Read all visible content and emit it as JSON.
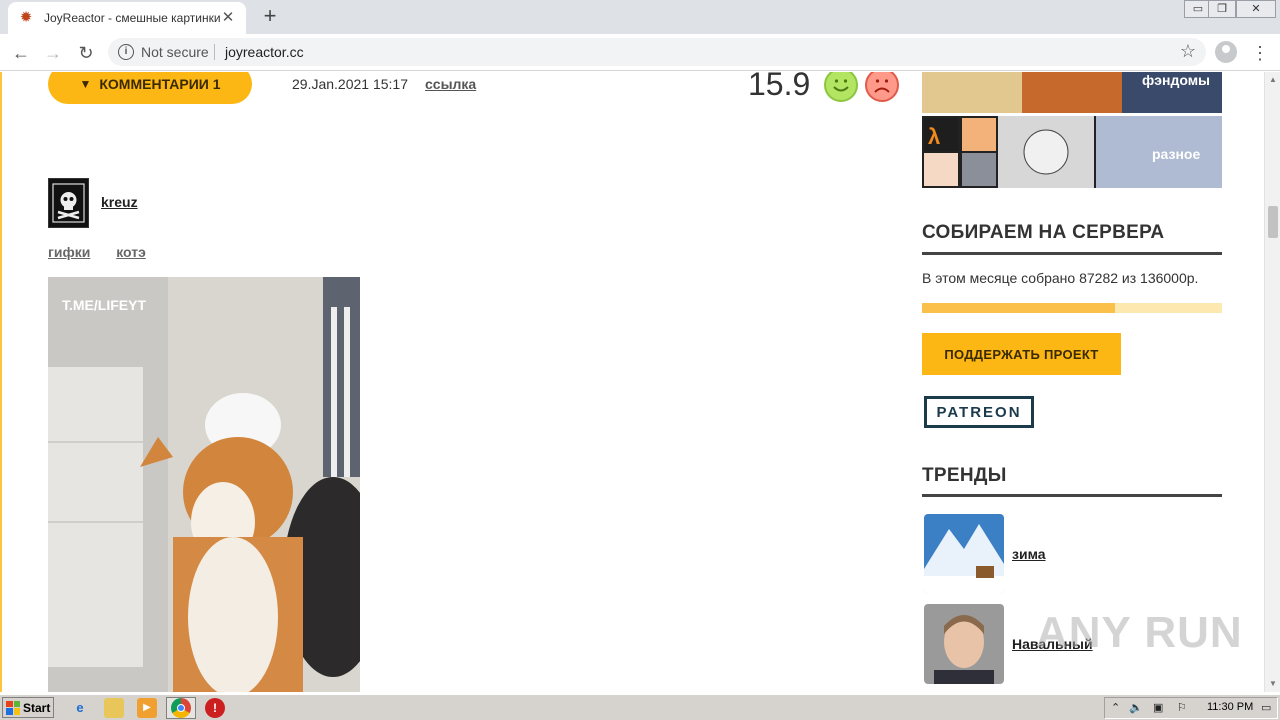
{
  "browser": {
    "tab_title": "JoyReactor - смешные картинки и",
    "tab_close": "✕",
    "new_tab": "+",
    "security": "Not secure",
    "url": "joyreactor.cc",
    "window_controls": [
      "▭",
      "❐",
      "✕"
    ]
  },
  "post": {
    "comments_label": "КОММЕНТАРИИ 1",
    "date": "29.Jan.2021 15:17",
    "link_label": "ссылка",
    "rating": "15.9",
    "username": "kreuz",
    "tags": [
      "гифки",
      "котэ"
    ],
    "image_watermark": "T.ME/LIFEYT"
  },
  "sidebar": {
    "fandoms_label": "фэндомы",
    "misc_label": "разное",
    "fundraise": {
      "title": "СОБИРАЕМ НА СЕРВЕРА",
      "text": "В этом месяце собрано 87282 из 136000р.",
      "collected": 87282,
      "goal": 136000,
      "support_label": "ПОДДЕРЖАТЬ ПРОЕКТ",
      "patreon_label": "PATREON"
    },
    "trends": {
      "title": "ТРЕНДЫ",
      "items": [
        {
          "label": "зима",
          "icon": "winter-landscape-thumbnail"
        },
        {
          "label": "Навальный",
          "icon": "portrait-thumbnail"
        }
      ]
    }
  },
  "watermark": "ANY RUN",
  "taskbar": {
    "start_label": "Start",
    "clock": "11:30 PM"
  },
  "colors": {
    "accent": "#fdb714",
    "progress_fill": "#fbc04a",
    "progress_bg": "#fde8b0",
    "patreon": "#1b3a4b"
  }
}
